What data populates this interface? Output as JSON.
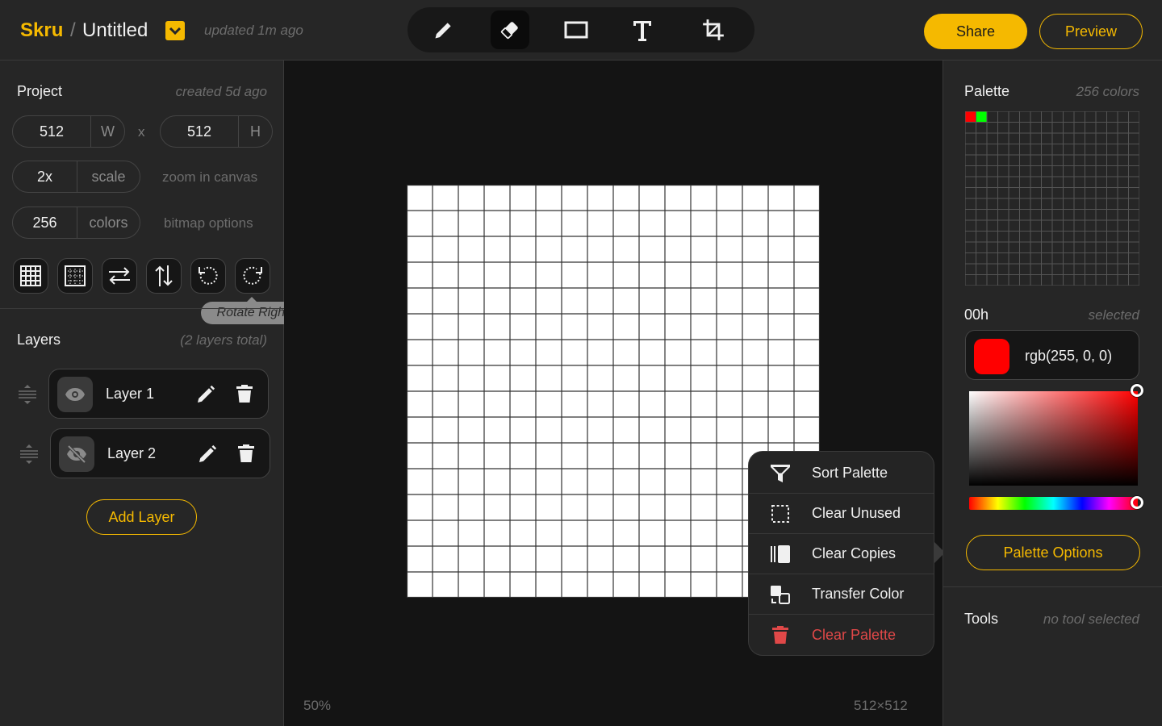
{
  "header": {
    "brand": "Skru",
    "separator": "/",
    "title": "Untitled",
    "updated": "updated 1m ago",
    "share_label": "Share",
    "preview_label": "Preview",
    "tools": [
      "pencil-icon",
      "eraser-icon",
      "rectangle-icon",
      "text-icon",
      "crop-icon"
    ],
    "active_tool": "eraser-icon"
  },
  "project": {
    "title": "Project",
    "created": "created 5d ago",
    "width": "512",
    "width_unit": "W",
    "times": "x",
    "height": "512",
    "height_unit": "H",
    "scale": "2x",
    "scale_unit": "scale",
    "scale_hint": "zoom in canvas",
    "colors": "256",
    "colors_unit": "colors",
    "colors_hint": "bitmap options",
    "actions": [
      "grid-icon",
      "selection-grid-icon",
      "flip-horizontal-icon",
      "flip-vertical-icon",
      "rotate-left-icon",
      "rotate-right-icon"
    ],
    "tooltip": "Rotate Right"
  },
  "layers": {
    "title": "Layers",
    "total": "(2 layers total)",
    "items": [
      {
        "name": "Layer 1",
        "visible": true
      },
      {
        "name": "Layer 2",
        "visible": false
      }
    ],
    "add_label": "Add Layer"
  },
  "canvas": {
    "zoom": "50%",
    "dimensions": "512×512",
    "grid_cells": 16,
    "background": "#ffffff"
  },
  "palette_menu": {
    "items": [
      {
        "label": "Sort Palette",
        "icon": "filter-icon"
      },
      {
        "label": "Clear Unused",
        "icon": "dashed-square-icon"
      },
      {
        "label": "Clear Copies",
        "icon": "copies-icon"
      },
      {
        "label": "Transfer Color",
        "icon": "transfer-icon"
      },
      {
        "label": "Clear Palette",
        "icon": "trash-icon",
        "danger": true
      }
    ]
  },
  "palette": {
    "title": "Palette",
    "count": "256 colors",
    "colors": [
      "#ff0000",
      "#00ff00"
    ],
    "grid_size": 16,
    "selected_index": "00h",
    "selected_note": "selected",
    "selected_color": "#ff0000",
    "selected_rgb": "rgb(255, 0, 0)",
    "options_label": "Palette Options"
  },
  "tools": {
    "title": "Tools",
    "note": "no tool selected"
  },
  "colors": {
    "accent": "#f5b900",
    "danger": "#e04848"
  }
}
